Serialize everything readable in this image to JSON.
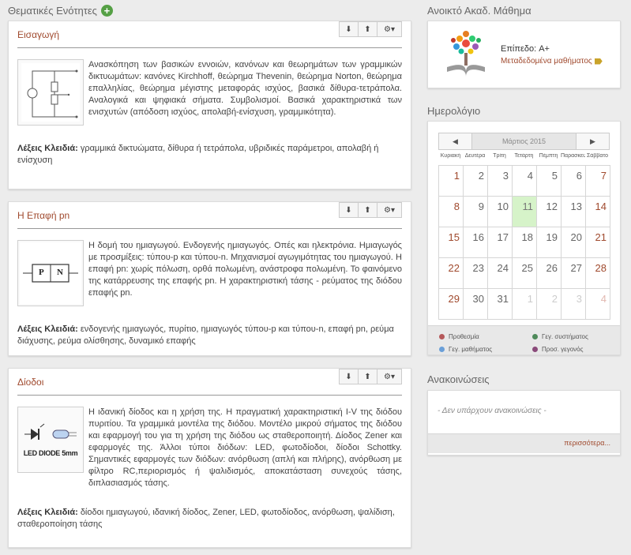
{
  "left": {
    "heading": "Θεματικές Ενότητες",
    "add_icon_glyph": "+",
    "keywords_label": "Λέξεις Κλειδιά:",
    "units": [
      {
        "title": "Εισαγωγή",
        "description": "Ανασκόπηση των βασικών εννοιών, κανόνων και θεωρημάτων των γραμμικών δικτυωμάτων: κανόνες Kirchhoff, θεώρημα Thevenin, θεώρημα Norton, θεώρημα επαλληλίας, θεώρημα μέγιστης μεταφοράς ισχύος, βασικά δίθυρα-τετράπολα. Αναλογικά και ψηφιακά σήματα. Συμβολισμοί. Βασικά χαρακτηριστικά των ενισχυτών (απόδοση ισχύος, απολαβή-ενίσχυση, γραμμικότητα).",
        "keywords": "γραμμικά δικτυώματα, δίθυρα ή τετράπολα, υβριδικές παράμετροι, απολαβή ή ενίσχυση"
      },
      {
        "title": "Η Επαφή pn",
        "description": "Η δομή του ημιαγωγού. Ενδογενής ημιαγωγός. Οπές και ηλεκτρόνια. Ημιαγωγός με προσμίξεις: τύπου-p και τύπου-n. Μηχανισμοί αγωγιμότητας του ημιαγωγού. Η επαφή pn: χωρίς πόλωση, ορθά πολωμένη, ανάστροφα πολωμένη. Το φαινόμενο της κατάρρευσης της επαφής pn. Η χαρακτηριστική τάσης - ρεύματος της διόδου επαφής pn.",
        "keywords": "ενδογενής ημιαγωγός, πυρίτιο, ημιαγωγός τύπου-p και τύπου-n, επαφή pn, ρεύμα διάχυσης, ρεύμα ολίσθησης, δυναμικό επαφής",
        "thumb_labels": [
          "P",
          "N"
        ]
      },
      {
        "title": "Δίοδοι",
        "description": "Η ιδανική δίοδος και η χρήση της. Η πραγματική χαρακτηριστική I-V της διόδου πυριτίου. Τα γραμμικά μοντέλα της διόδου. Μοντέλο μικρού σήματος της διόδου και εφαρμογή του για τη χρήση της διόδου ως σταθεροποιητή. Δίοδος Zener και εφαρμογές της. Άλλοι τύποι διόδων: LED, φωτοδίοδοι, δίοδοι Schottky. Σημαντικές εφαρμογές των διόδων: ανόρθωση (απλή και πλήρης), ανόρθωση με φίλτρο RC,περιορισμός ή ψαλιδισμός, αποκατάσταση συνεχούς τάσης, διπλασιασμός τάσης.",
        "keywords": "δίοδοι ημιαγωγού, ιδανική δίοδος, Zener, LED, φωτοδίοδος, ανόρθωση, ψαλίδιση, σταθεροποίηση τάσης",
        "thumb_label": "LED DIODE 5mm"
      }
    ],
    "buttons": {
      "down": "⬇",
      "up": "⬆",
      "settings": "⚙▾"
    }
  },
  "right": {
    "course": {
      "heading": "Ανοικτό Ακαδ. Μάθημα",
      "level": "Επίπεδο: A+",
      "metadata_link": "Μεταδεδομένα μαθήματος"
    },
    "calendar": {
      "heading": "Ημερολόγιο",
      "month": "Μάρτιος 2015",
      "prev": "◀",
      "next": "▶",
      "weekdays": [
        "Κυριακή",
        "Δευτέρα",
        "Τρίτη",
        "Τετάρτη",
        "Πέμπτη",
        "Παρασκευή",
        "Σάββατο"
      ],
      "today": 11,
      "weeks": [
        [
          1,
          2,
          3,
          4,
          5,
          6,
          7
        ],
        [
          8,
          9,
          10,
          11,
          12,
          13,
          14
        ],
        [
          15,
          16,
          17,
          18,
          19,
          20,
          21
        ],
        [
          22,
          23,
          24,
          25,
          26,
          27,
          28
        ],
        [
          29,
          30,
          31,
          1,
          2,
          3,
          4
        ]
      ],
      "legend": [
        {
          "label": "Προθεσμία",
          "color": "#b5585a"
        },
        {
          "label": "Γεγ. συστήματος",
          "color": "#4e8a5a"
        },
        {
          "label": "Γεγ. μαθήματος",
          "color": "#6a9fd8"
        },
        {
          "label": "Προσ. γεγονός",
          "color": "#8a4a7a"
        }
      ]
    },
    "announcements": {
      "heading": "Ανακοινώσεις",
      "empty": "- Δεν υπάρχουν ανακοινώσεις -",
      "more": "περισσότερα..."
    }
  },
  "colors": {
    "accent": "#a04a2e",
    "add_green": "#55a045",
    "today_bg": "#d6f3c9"
  }
}
